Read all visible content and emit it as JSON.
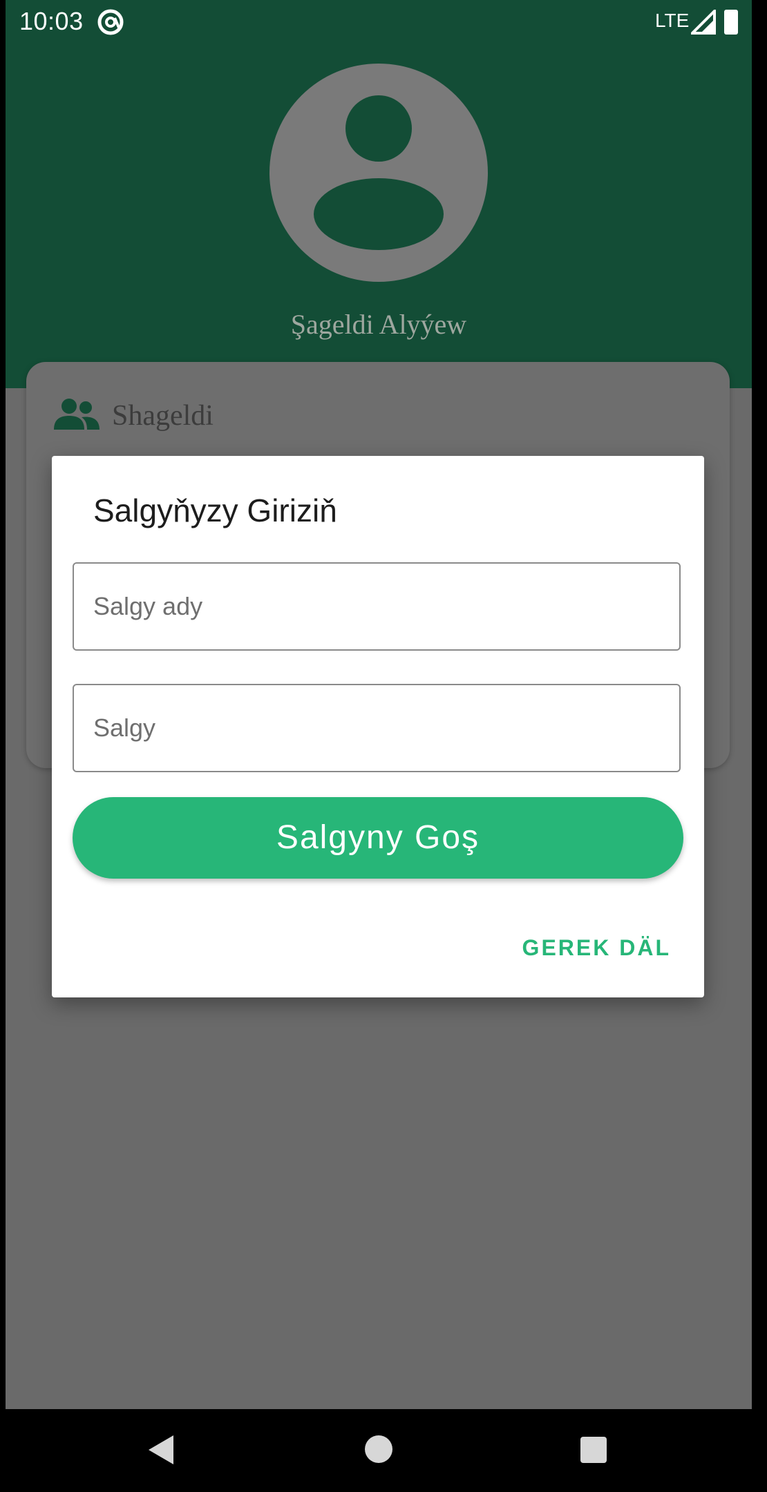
{
  "status_bar": {
    "time": "10:03",
    "network": "LTE",
    "icons": [
      "at-sign-icon",
      "signal-icon",
      "battery-icon"
    ]
  },
  "profile": {
    "name": "Şageldi Alyýew",
    "avatar_icon": "account-circle-icon"
  },
  "card": {
    "icon": "people-icon",
    "label": "Shageldi"
  },
  "dialog": {
    "title": "Salgyňyzy Giriziň",
    "address_name_placeholder": "Salgy ady",
    "address_name_value": "",
    "address_placeholder": "Salgy",
    "address_value": "",
    "primary_button": "Salgyny Goş",
    "dismiss_button": "GEREK DÄL"
  },
  "navigation": {
    "icons": [
      "back-icon",
      "home-icon",
      "recents-icon"
    ]
  },
  "colors": {
    "primary_dark": "#134d36",
    "accent": "#27b678",
    "scrim": "#6a6a6a",
    "dialog_bg": "#ffffff"
  }
}
